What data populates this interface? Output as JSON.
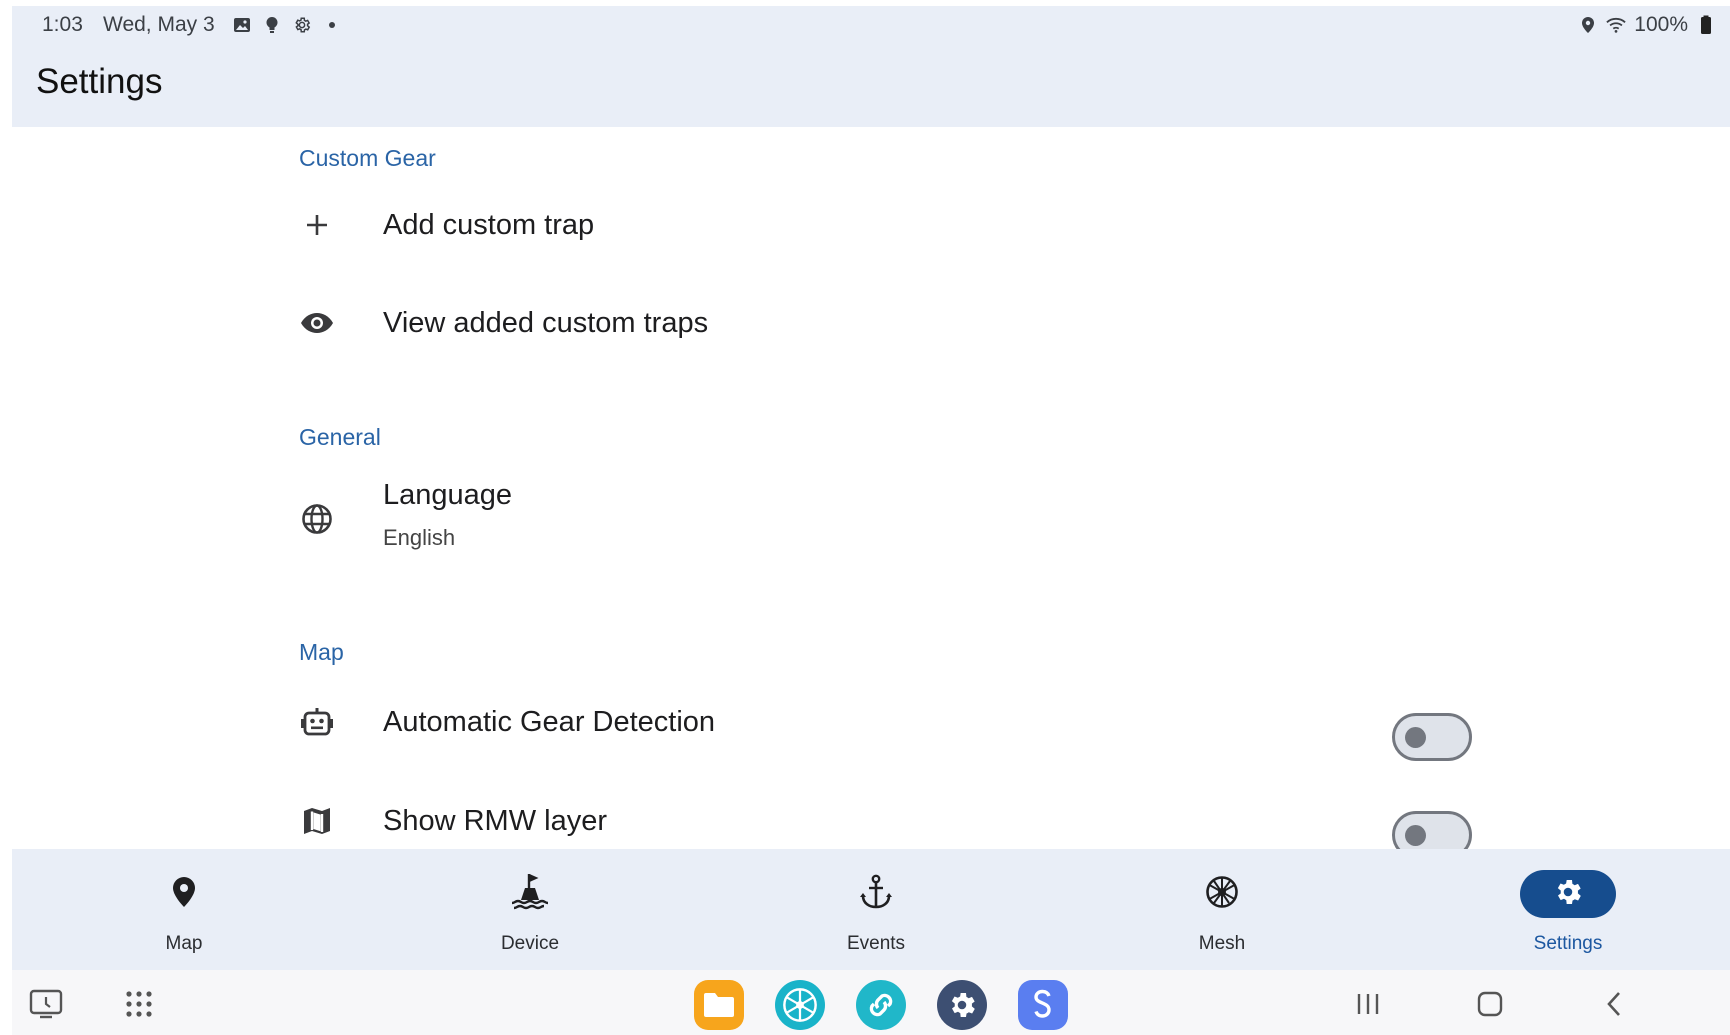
{
  "status_bar": {
    "time": "1:03",
    "date": "Wed, May 3",
    "battery": "100%",
    "left_icons": [
      "gallery-icon",
      "bulb-icon",
      "settings-gear-icon",
      "dot-icon"
    ],
    "right_icons": [
      "location-icon",
      "wifi-icon",
      "battery-icon"
    ]
  },
  "app_bar": {
    "title": "Settings"
  },
  "sections": {
    "custom_gear": {
      "header": "Custom Gear",
      "add_label": "Add custom trap",
      "view_label": "View added custom traps"
    },
    "general": {
      "header": "General",
      "language_label": "Language",
      "language_value": "English"
    },
    "map": {
      "header": "Map",
      "auto_gear_label": "Automatic Gear Detection",
      "auto_gear_on": false,
      "rmw_label": "Show RMW layer",
      "rmw_on": false
    }
  },
  "bottom_nav": {
    "map": "Map",
    "device": "Device",
    "events": "Events",
    "mesh": "Mesh",
    "settings": "Settings",
    "active": "settings"
  },
  "colors": {
    "accent": "#164d8e",
    "section_header": "#2a64a6",
    "bar_bg": "#e9eef7"
  },
  "dock": {
    "apps": [
      "my-files-icon",
      "mesh-app-icon",
      "link-app-icon",
      "settings-app-icon",
      "samsung-pass-icon"
    ]
  }
}
